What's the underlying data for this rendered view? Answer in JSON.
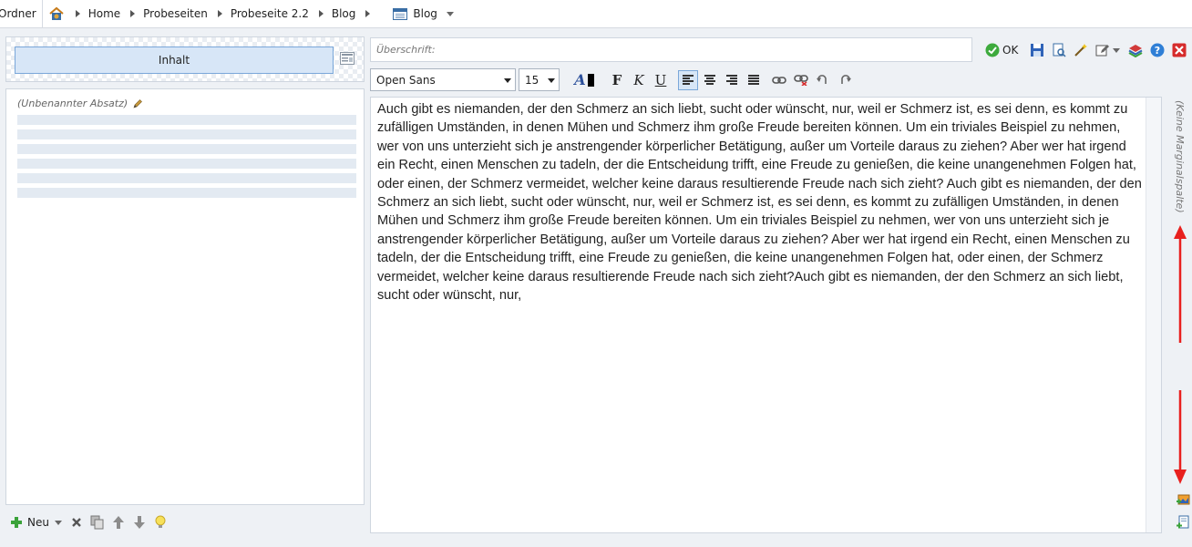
{
  "breadcrumb": {
    "folder_label": "Ordner",
    "items": [
      "Home",
      "Probeseiten",
      "Probeseite 2.2",
      "Blog"
    ],
    "current_page": "Blog"
  },
  "left_panel": {
    "content_tab": "Inhalt",
    "paragraph_label": "(Unbenannter Absatz)",
    "new_label": "Neu"
  },
  "editor": {
    "heading_placeholder": "Überschrift:",
    "ok_label": "OK",
    "font": "Open Sans",
    "font_size": "15",
    "bold_label": "F",
    "italic_label": "K",
    "underline_label": "U",
    "color_label": "A",
    "text": "Auch gibt es niemanden, der den Schmerz an sich liebt, sucht oder wünscht, nur, weil er Schmerz ist, es sei denn, es kommt zu zufälligen Umständen, in denen Mühen und Schmerz ihm große Freude bereiten können. Um ein triviales Beispiel zu nehmen, wer von uns unterzieht sich je anstrengender körperlicher Betätigung, außer um Vorteile daraus zu ziehen? Aber wer hat irgend ein Recht, einen Menschen zu tadeln, der die Entscheidung trifft, eine Freude zu genießen, die keine unangenehmen Folgen hat, oder einen, der Schmerz vermeidet, welcher keine daraus resultierende Freude nach sich zieht? Auch gibt es niemanden, der den Schmerz an sich liebt, sucht oder wünscht, nur, weil er Schmerz ist, es sei denn, es kommt zu zufälligen Umständen, in denen Mühen und Schmerz ihm große Freude bereiten können. Um ein triviales Beispiel zu nehmen, wer von uns unterzieht sich je anstrengender körperlicher Betätigung, außer um Vorteile daraus zu ziehen? Aber wer hat irgend ein Recht, einen Menschen zu tadeln, der die Entscheidung trifft, eine Freude zu genießen, die keine unangenehmen Folgen hat, oder einen, der Schmerz vermeidet, welcher keine daraus resultierende Freude nach sich zieht?Auch gibt es niemanden, der den Schmerz an sich liebt, sucht oder wünscht, nur,"
  },
  "margin_column_label": "(Keine Marginalspalte)",
  "colors": {
    "accent_blue": "#d7e6f7",
    "accent_border": "#7aa7d9",
    "annotation_red": "#e8201e"
  },
  "icons": [
    "home-icon",
    "page-icon",
    "layout-icon",
    "pencil-icon",
    "add-icon",
    "delete-icon",
    "copy-icon",
    "move-up-icon",
    "move-down-icon",
    "lightbulb-icon",
    "ok-check-icon",
    "save-icon",
    "preview-icon",
    "magic-wand-icon",
    "edit-icon",
    "layers-icon",
    "help-icon",
    "close-icon",
    "link-icon",
    "unlink-icon",
    "undo-icon",
    "redo-icon",
    "insert-image-icon",
    "insert-page-icon"
  ]
}
